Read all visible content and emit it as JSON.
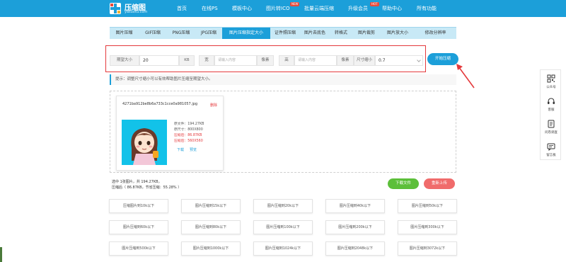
{
  "header": {
    "logo_name": "压缩图",
    "logo_url": "yasuotu.com",
    "nav": [
      {
        "label": "首页"
      },
      {
        "label": "在线PS"
      },
      {
        "label": "模板中心"
      },
      {
        "label": "图片转ICO",
        "badge": "NEW"
      },
      {
        "label": "批量云端压缩"
      },
      {
        "label": "升级会员",
        "badge": "HOT"
      },
      {
        "label": "帮助中心"
      },
      {
        "label": "所有功能"
      }
    ]
  },
  "tabs": [
    "图片压缩",
    "GIF压缩",
    "PNG压缩",
    "JPG压缩",
    "图片压缩指定大小",
    "证件照压缩",
    "图片去底色",
    "转格式",
    "图片裁剪",
    "图片放大小",
    "修改分辨率"
  ],
  "active_tab": "图片压缩指定大小",
  "params": {
    "target_label": "期望大小",
    "target_value": "20",
    "target_unit": "KB",
    "width_label": "宽",
    "width_placeholder": "请输入内容",
    "width_unit": "像素",
    "height_label": "高",
    "height_placeholder": "请输入内容",
    "height_unit": "像素",
    "scale_label": "尺寸缩小",
    "scale_value": "0.7"
  },
  "start_button": "开始压缩",
  "tip": "提示：调整尺寸缩小可以有效帮助图片压缩至期望大小。",
  "file": {
    "name": "4271ba912be8b6a733c1cce0a981057.jpg",
    "delete": "删除",
    "original_size": "原文件：194.27KB",
    "original_dim": "原尺寸：800X800",
    "compressed_size": "压缩后：86.87KB",
    "compressed_dim": "压缩后：560X560",
    "download": "下载",
    "preview": "预览"
  },
  "summary": {
    "line1": "选中 1张图片，共 194.27KB，",
    "line2": "压缩后（ 86.87KB，节省压缩：55.28% ）"
  },
  "download_button": "下载文件",
  "reupload_button": "重新上传",
  "presets": [
    "压缩图片到10k以下",
    "图片压缩到15k以下",
    "图片压缩到20k以下",
    "图片压缩到40k以下",
    "图片压缩到50k以下",
    "图片压缩到60k以下",
    "图片压缩到80k以下",
    "图片压缩到100k以下",
    "图片压缩到200k以下",
    "图片压缩到300k以下",
    "图片压缩到500k以下",
    "图片压缩到1000k以下",
    "图片压缩到1024k以下",
    "图片压缩到2048k以下",
    "图片压缩到3072k以下"
  ],
  "side_panel": [
    {
      "icon": "wechat-qr-icon",
      "label": "公众号"
    },
    {
      "icon": "headset-icon",
      "label": "客服"
    },
    {
      "icon": "survey-icon",
      "label": "问卷调查"
    },
    {
      "icon": "message-icon",
      "label": "留言板"
    }
  ],
  "colors": {
    "brand": "#1c9fd9",
    "accent_red": "#e4393c",
    "green": "#5cbf3a",
    "pink": "#f06b6b"
  }
}
